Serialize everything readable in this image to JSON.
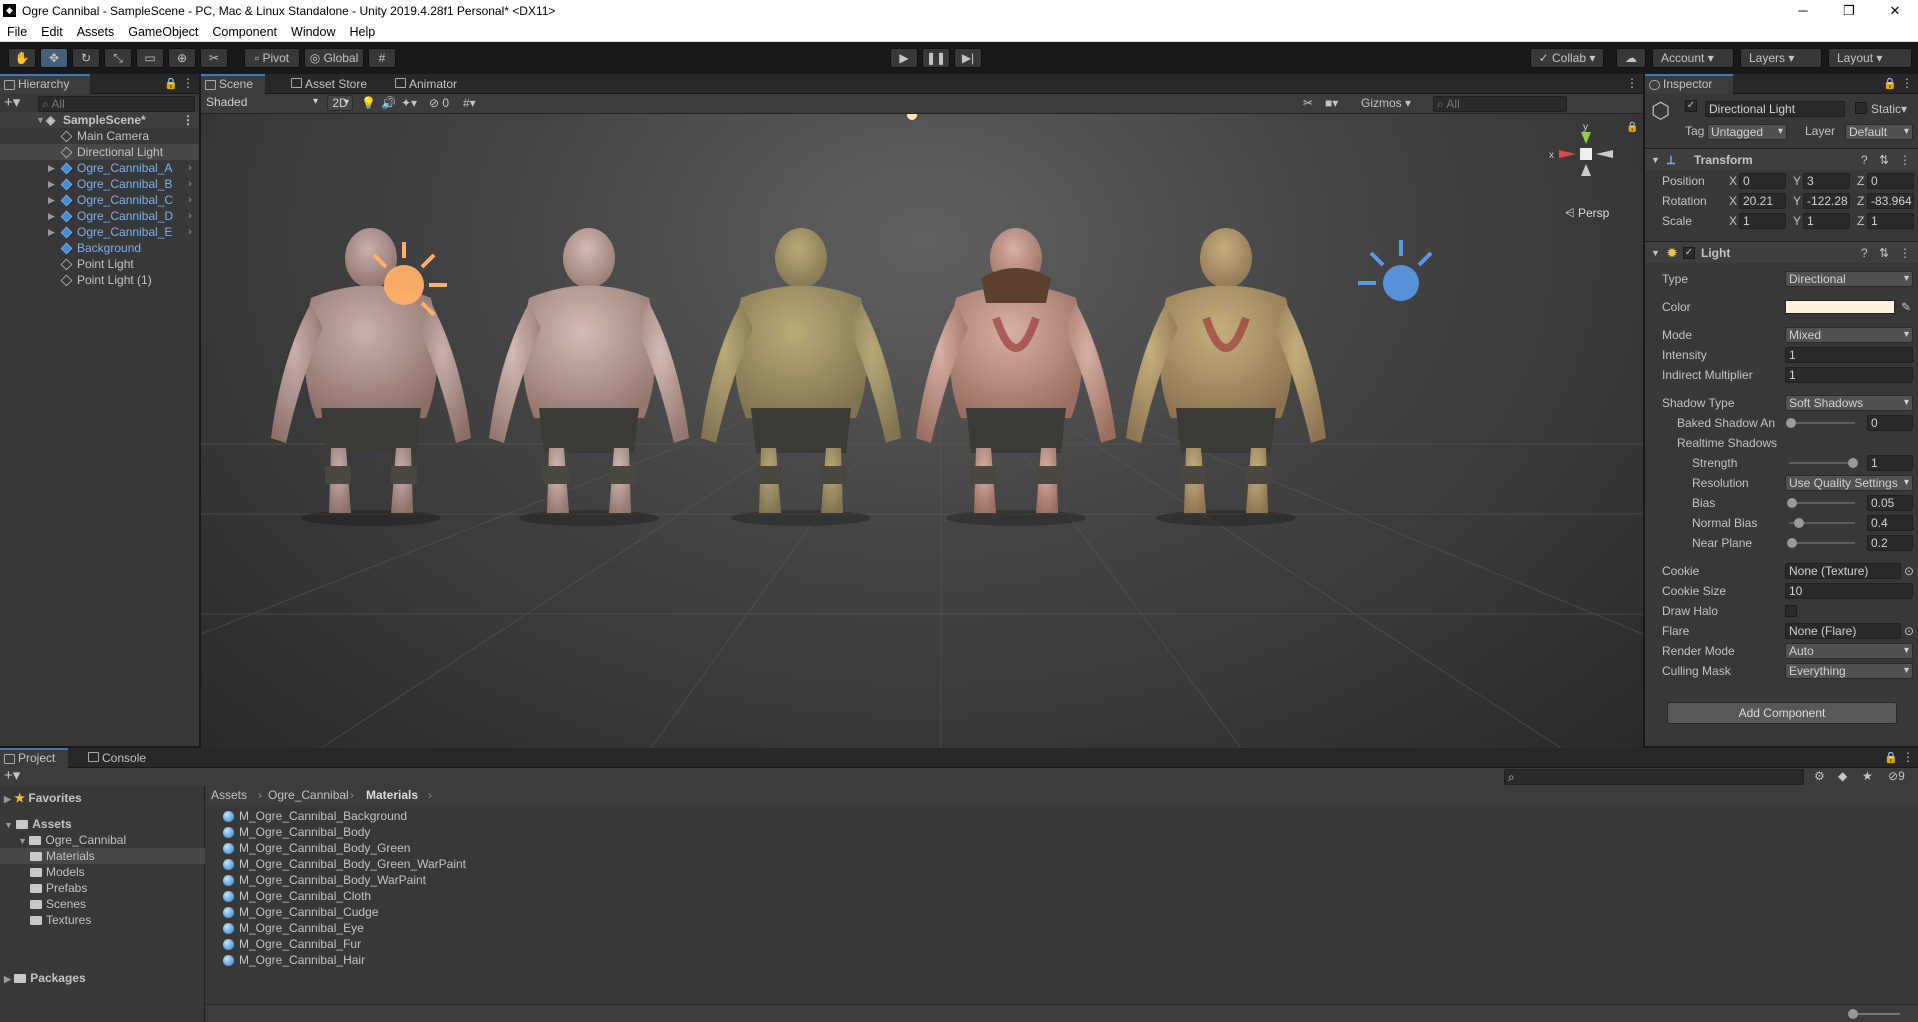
{
  "window": {
    "title": "Ogre Cannibal - SampleScene - PC, Mac & Linux Standalone - Unity 2019.4.28f1 Personal* <DX11>",
    "logo": "unity-logo"
  },
  "menu": [
    "File",
    "Edit",
    "Assets",
    "GameObject",
    "Component",
    "Window",
    "Help"
  ],
  "toolbar": {
    "pivot": "Pivot",
    "global": "Global",
    "collab": "Collab",
    "account": "Account",
    "layers": "Layers",
    "layout": "Layout"
  },
  "hierarchy": {
    "tab": "Hierarchy",
    "search_placeholder": "All",
    "scene": "SampleScene*",
    "items": [
      {
        "label": "Main Camera",
        "prefab": false,
        "expandable": false,
        "selected": false
      },
      {
        "label": "Directional Light",
        "prefab": false,
        "expandable": false,
        "selected": true
      },
      {
        "label": "Ogre_Cannibal_A",
        "prefab": true,
        "expandable": true,
        "selected": false
      },
      {
        "label": "Ogre_Cannibal_B",
        "prefab": true,
        "expandable": true,
        "selected": false
      },
      {
        "label": "Ogre_Cannibal_C",
        "prefab": true,
        "expandable": true,
        "selected": false
      },
      {
        "label": "Ogre_Cannibal_D",
        "prefab": true,
        "expandable": true,
        "selected": false
      },
      {
        "label": "Ogre_Cannibal_E",
        "prefab": true,
        "expandable": true,
        "selected": false
      },
      {
        "label": "Background",
        "prefab": true,
        "expandable": false,
        "selected": false
      },
      {
        "label": "Point Light",
        "prefab": false,
        "expandable": false,
        "selected": false
      },
      {
        "label": "Point Light (1)",
        "prefab": false,
        "expandable": false,
        "selected": false
      }
    ]
  },
  "scene": {
    "tabs": [
      "Scene",
      "Asset Store",
      "Animator"
    ],
    "shading": "Shaded",
    "mode_2d": "2D",
    "hidden_count": "0",
    "gizmos": "Gizmos",
    "search_placeholder": "All",
    "persp": "Persp",
    "axis_x": "x",
    "axis_y": "y"
  },
  "inspector": {
    "tab": "Inspector",
    "object_name": "Directional Light",
    "static": "Static",
    "tag_label": "Tag",
    "tag": "Untagged",
    "layer_label": "Layer",
    "layer": "Default",
    "transform": {
      "title": "Transform",
      "position_label": "Position",
      "rotation_label": "Rotation",
      "scale_label": "Scale",
      "position": [
        "0",
        "3",
        "0"
      ],
      "rotation": [
        "20.21",
        "-122.28",
        "-83.964"
      ],
      "scale": [
        "1",
        "1",
        "1"
      ]
    },
    "light": {
      "title": "Light",
      "type_label": "Type",
      "type": "Directional",
      "color_label": "Color",
      "color": "#fff3df",
      "mode_label": "Mode",
      "mode": "Mixed",
      "intensity_label": "Intensity",
      "intensity": "1",
      "indirect_label": "Indirect Multiplier",
      "indirect": "1",
      "shadow_type_label": "Shadow Type",
      "shadow_type": "Soft Shadows",
      "baked_label": "Baked Shadow An",
      "baked": "0",
      "realtime_label": "Realtime Shadows",
      "strength_label": "Strength",
      "strength": "1",
      "resolution_label": "Resolution",
      "resolution": "Use Quality Settings",
      "bias_label": "Bias",
      "bias": "0.05",
      "normal_bias_label": "Normal Bias",
      "normal_bias": "0.4",
      "near_plane_label": "Near Plane",
      "near_plane": "0.2",
      "cookie_label": "Cookie",
      "cookie": "None (Texture)",
      "cookie_size_label": "Cookie Size",
      "cookie_size": "10",
      "draw_halo_label": "Draw Halo",
      "flare_label": "Flare",
      "flare": "None (Flare)",
      "render_mode_label": "Render Mode",
      "render_mode": "Auto",
      "culling_label": "Culling Mask",
      "culling": "Everything"
    },
    "add_component": "Add Component"
  },
  "project": {
    "tabs": [
      "Project",
      "Console"
    ],
    "hidden_count": "9",
    "favorites": "Favorites",
    "assets": "Assets",
    "tree": [
      "Ogre_Cannibal",
      "Materials",
      "Models",
      "Prefabs",
      "Scenes",
      "Textures"
    ],
    "packages": "Packages",
    "breadcrumb": [
      "Assets",
      "Ogre_Cannibal",
      "Materials"
    ],
    "files": [
      "M_Ogre_Cannibal_Background",
      "M_Ogre_Cannibal_Body",
      "M_Ogre_Cannibal_Body_Green",
      "M_Ogre_Cannibal_Body_Green_WarPaint",
      "M_Ogre_Cannibal_Body_WarPaint",
      "M_Ogre_Cannibal_Cloth",
      "M_Ogre_Cannibal_Cudge",
      "M_Ogre_Cannibal_Eye",
      "M_Ogre_Cannibal_Fur",
      "M_Ogre_Cannibal_Hair"
    ]
  },
  "colors": {
    "accent": "#3a79bb",
    "prefab_text": "#7cb0ef",
    "panel_bg": "#383838"
  }
}
